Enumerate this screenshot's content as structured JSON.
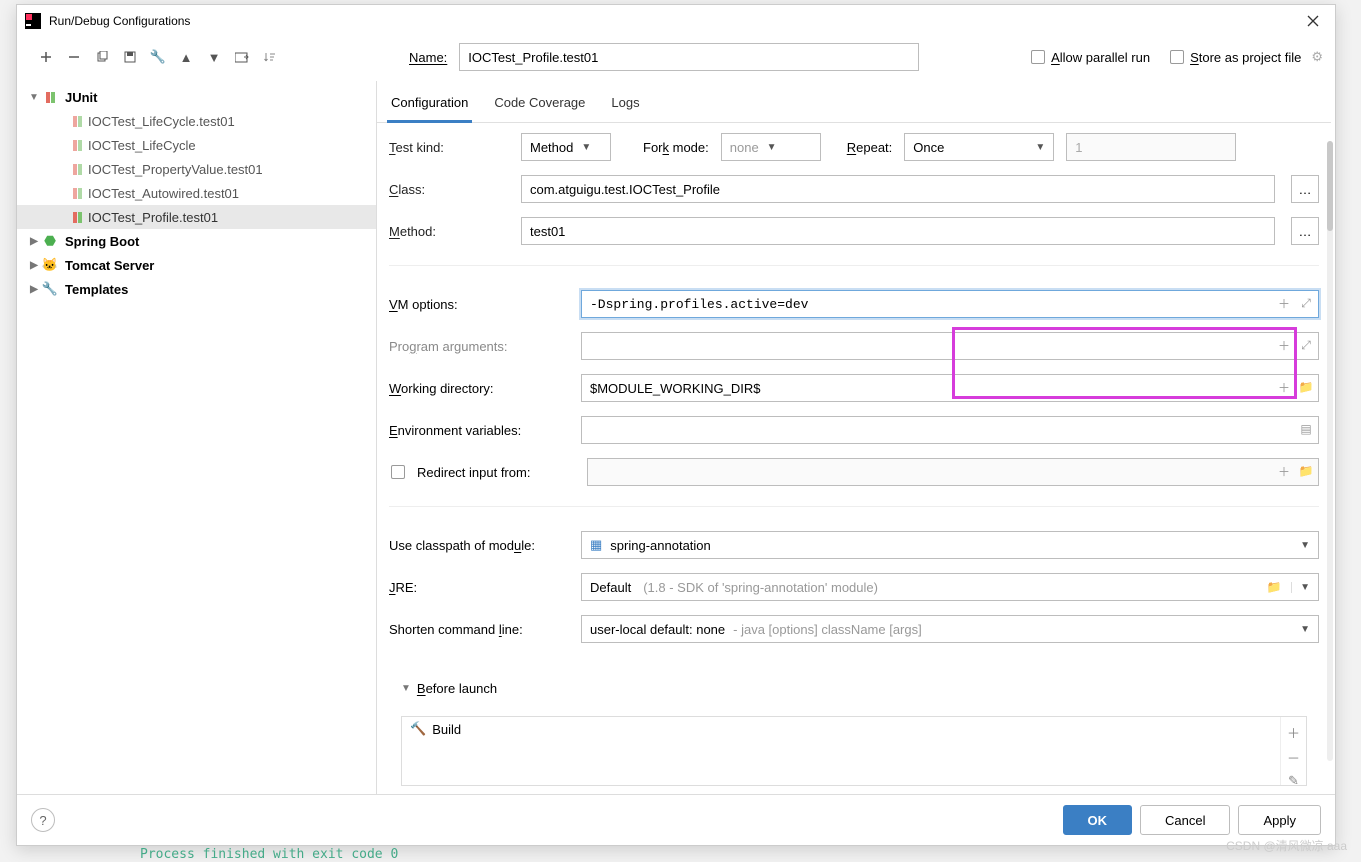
{
  "dialog": {
    "title": "Run/Debug Configurations"
  },
  "toolbar": {
    "buttons": [
      "add",
      "remove",
      "copy",
      "save",
      "wrench",
      "up",
      "down",
      "folder-move",
      "sort"
    ]
  },
  "name": {
    "label": "Name:",
    "value": "IOCTest_Profile.test01"
  },
  "checks": {
    "allow_parallel": "Allow parallel run",
    "store_as": "Store as project file"
  },
  "tree": {
    "junit": {
      "label": "JUnit",
      "children": [
        {
          "label": "IOCTest_LifeCycle.test01"
        },
        {
          "label": "IOCTest_LifeCycle"
        },
        {
          "label": "IOCTest_PropertyValue.test01"
        },
        {
          "label": "IOCTest_Autowired.test01"
        },
        {
          "label": "IOCTest_Profile.test01",
          "selected": true
        }
      ]
    },
    "spring_boot": {
      "label": "Spring Boot"
    },
    "tomcat": {
      "label": "Tomcat Server"
    },
    "templates": {
      "label": "Templates"
    }
  },
  "tabs": {
    "active": "Configuration",
    "items": [
      "Configuration",
      "Code Coverage",
      "Logs"
    ]
  },
  "form": {
    "test_kind": {
      "label": "Test kind:",
      "value": "Method"
    },
    "fork_mode": {
      "label": "Fork mode:",
      "value": "none"
    },
    "repeat": {
      "label": "Repeat:",
      "value": "Once",
      "count": "1"
    },
    "class": {
      "label": "Class:",
      "value": "com.atguigu.test.IOCTest_Profile"
    },
    "method": {
      "label": "Method:",
      "value": "test01"
    },
    "vm_options": {
      "label": "VM options:",
      "value": "-Dspring.profiles.active=dev"
    },
    "program_args": {
      "label": "Program arguments:",
      "value": ""
    },
    "working_dir": {
      "label": "Working directory:",
      "value": "$MODULE_WORKING_DIR$"
    },
    "env_vars": {
      "label": "Environment variables:",
      "value": ""
    },
    "redirect": {
      "label": "Redirect input from:"
    },
    "classpath": {
      "label": "Use classpath of module:",
      "value": "spring-annotation"
    },
    "jre": {
      "label": "JRE:",
      "value": "Default",
      "hint": "(1.8 - SDK of 'spring-annotation' module)"
    },
    "shorten": {
      "label": "Shorten command line:",
      "value": "user-local default: none",
      "hint": " - java [options] className [args]"
    }
  },
  "before": {
    "label": "Before launch",
    "task": "Build"
  },
  "buttons": {
    "ok": "OK",
    "cancel": "Cancel",
    "apply": "Apply"
  },
  "watermark": "CSDN @清风微凉 aaa",
  "foot": "Process finished with exit code 0"
}
